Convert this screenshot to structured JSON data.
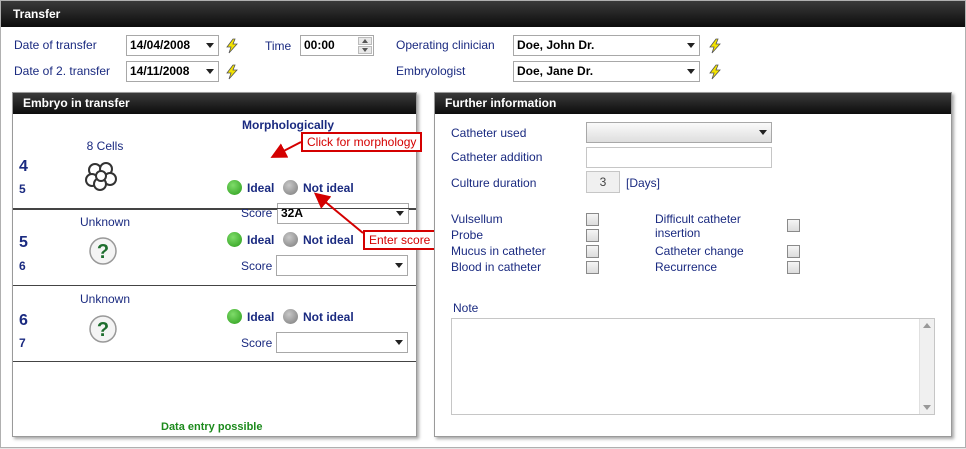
{
  "window": {
    "title": "Transfer"
  },
  "header": {
    "date_of_transfer_label": "Date of transfer",
    "date_of_transfer": "14/04/2008",
    "date_of_2_transfer_label": "Date of 2. transfer",
    "date_of_2_transfer": "14/11/2008",
    "time_label": "Time",
    "time": "00:00",
    "operating_clinician_label": "Operating clinician",
    "operating_clinician": "Doe, John Dr.",
    "embryologist_label": "Embryologist",
    "embryologist": "Doe, Jane Dr."
  },
  "embryo_panel": {
    "title": "Embryo in transfer",
    "column_header": "Morphologically",
    "ideal_label": "Ideal",
    "not_ideal_label": "Not ideal",
    "score_label": "Score",
    "footer": "Data entry possible",
    "embryos": [
      {
        "number": "4",
        "sub": "5",
        "type": "8 Cells",
        "icon": "cells-icon",
        "score": "32A"
      },
      {
        "number": "5",
        "sub": "6",
        "type": "Unknown",
        "icon": "question-icon",
        "score": ""
      },
      {
        "number": "6",
        "sub": "7",
        "type": "Unknown",
        "icon": "question-icon",
        "score": ""
      }
    ]
  },
  "annotations": {
    "morphology": "Click for morphology",
    "score": "Enter score"
  },
  "further_panel": {
    "title": "Further information",
    "catheter_used_label": "Catheter used",
    "catheter_used": "",
    "catheter_addition_label": "Catheter addition",
    "catheter_addition": "",
    "culture_duration_label": "Culture duration",
    "culture_duration": "3",
    "culture_duration_unit": "[Days]",
    "checks_left": [
      "Vulsellum",
      "Probe",
      "Mucus in catheter",
      "Blood in catheter"
    ],
    "checks_right": [
      "Difficult catheter insertion",
      "Catheter change",
      "Recurrence"
    ],
    "note_label": "Note",
    "note": ""
  },
  "colors": {
    "accent_text": "#1a2a80",
    "annotation": "#d40000",
    "ok_text": "#1c8a1c"
  }
}
